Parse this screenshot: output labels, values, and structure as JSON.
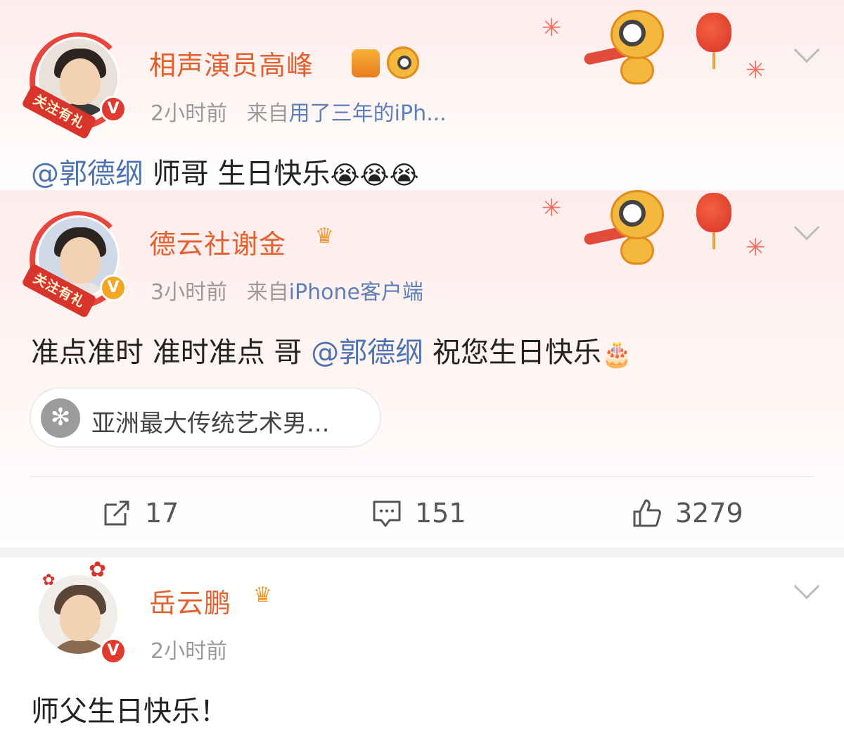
{
  "comments": [
    {
      "username": "相声演员高峰",
      "avatar_ribbon": "关注有礼",
      "verified_mark": "V",
      "time": "2小时前",
      "source_prefix": "来自",
      "source": "用了三年的iPh...",
      "mention": "@郭德纲",
      "text": " 师哥 生日快乐",
      "emoji": "😭😭😭"
    },
    {
      "username": "德云社谢金",
      "avatar_ribbon": "关注有礼",
      "verified_mark": "V",
      "time": "3小时前",
      "source_prefix": "来自",
      "source": "iPhone客户端",
      "text_before": "准点准时 准时准点 哥 ",
      "mention": "@郭德纲",
      "text_after": " 祝您生日快乐",
      "emoji": "🎂"
    },
    {
      "username": "岳云鹏",
      "verified_mark": "V",
      "time": "2小时前",
      "text": "师父生日快乐！"
    }
  ],
  "repost_card": {
    "icon": "✻",
    "text": "亚洲最大传统艺术男..."
  },
  "actions": {
    "repost_count": "17",
    "comment_count": "151",
    "like_count": "3279"
  },
  "icons": [
    "chevron-down-icon",
    "crown-icon",
    "medal-icon",
    "share-icon",
    "comment-icon",
    "like-icon",
    "tiger-mascot-icon",
    "lantern-icon",
    "firework-icon"
  ],
  "colors": {
    "username": "#e2612e",
    "mention": "#4d73b2",
    "meta": "#9a9a9a",
    "verified_gold": "#f2a623",
    "verified_red": "#e03a2f",
    "festive_red": "#d8342b"
  }
}
